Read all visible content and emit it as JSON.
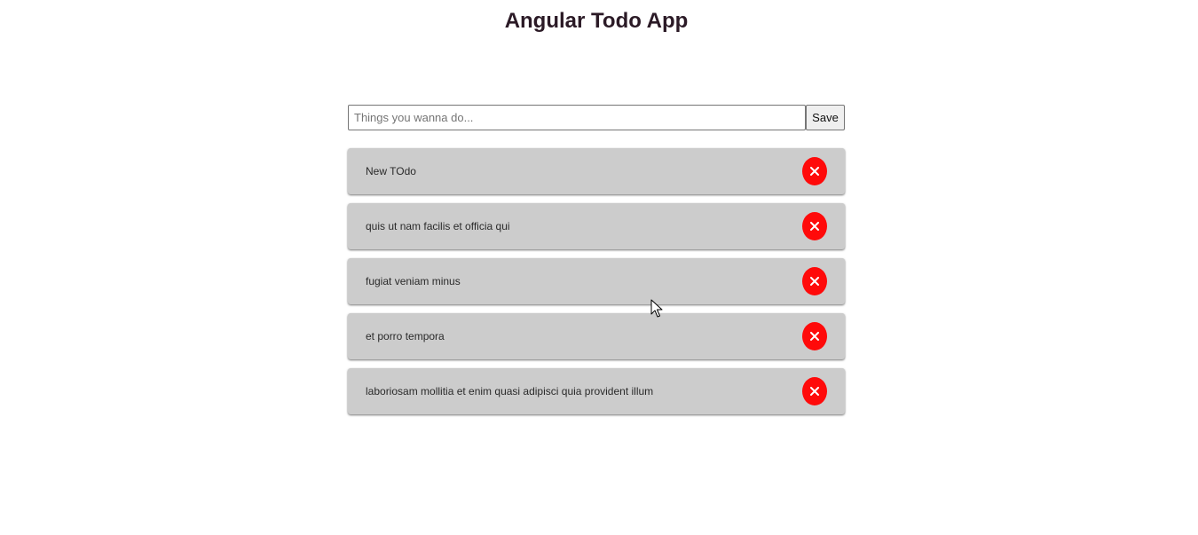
{
  "app": {
    "title": "Angular Todo App"
  },
  "form": {
    "placeholder": "Things you wanna do...",
    "value": "",
    "save_label": "Save"
  },
  "todos": [
    {
      "text": "New TOdo",
      "delete_icon": "close-icon"
    },
    {
      "text": "quis ut nam facilis et officia qui",
      "delete_icon": "close-icon"
    },
    {
      "text": "fugiat veniam minus",
      "delete_icon": "close-icon"
    },
    {
      "text": "et porro tempora",
      "delete_icon": "close-icon"
    },
    {
      "text": "laboriosam mollitia et enim quasi adipisci quia provident illum",
      "delete_icon": "close-icon"
    }
  ],
  "colors": {
    "title": "#2b1a26",
    "item_background": "#cccccc",
    "delete_button": "#ff0a0a"
  }
}
